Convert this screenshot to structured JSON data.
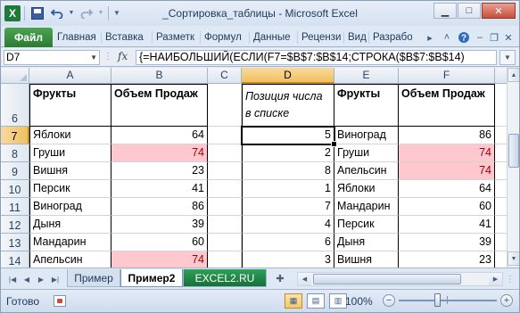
{
  "window": {
    "title": "_Сортировка_таблицы  -  Microsoft Excel",
    "app_icon": "excel-icon",
    "app_letter": "X"
  },
  "ribbon": {
    "file_tab": "Файл",
    "tabs": [
      "Главная",
      "Вставка",
      "Разметк",
      "Формул",
      "Данные",
      "Рецензи",
      "Вид",
      "Разрабо"
    ]
  },
  "formula_bar": {
    "name_box": "D7",
    "fx_label": "fx",
    "formula": "{=НАИБОЛЬШИЙ(ЕСЛИ(F7=$B$7:$B$14;СТРОКА($B$7:$B$14)"
  },
  "grid": {
    "columns": [
      "A",
      "B",
      "C",
      "D",
      "E",
      "F"
    ],
    "selected_column": "D",
    "rows": [
      "6",
      "7",
      "8",
      "9",
      "10",
      "11",
      "12",
      "13",
      "14"
    ],
    "selected_row": "7",
    "header_row": {
      "A": "Фрукты",
      "B": "Объем Продаж",
      "D": "Позиция числа в списке",
      "E": "Фрукты",
      "F": "Объем Продаж"
    },
    "data_rows": [
      {
        "A": "Яблоки",
        "B": "64",
        "D": "5",
        "E": "Виноград",
        "F": "86"
      },
      {
        "A": "Груши",
        "B": "74",
        "D": "2",
        "E": "Груши",
        "F": "74"
      },
      {
        "A": "Вишня",
        "B": "23",
        "D": "8",
        "E": "Апельсин",
        "F": "74"
      },
      {
        "A": "Персик",
        "B": "41",
        "D": "1",
        "E": "Яблоки",
        "F": "64"
      },
      {
        "A": "Виноград",
        "B": "86",
        "D": "7",
        "E": "Мандарин",
        "F": "60"
      },
      {
        "A": "Дыня",
        "B": "39",
        "D": "4",
        "E": "Персик",
        "F": "41"
      },
      {
        "A": "Мандарин",
        "B": "60",
        "D": "6",
        "E": "Дыня",
        "F": "39"
      },
      {
        "A": "Апельсин",
        "B": "74",
        "D": "3",
        "E": "Вишня",
        "F": "23"
      }
    ],
    "highlight_color": "#ffc7ce"
  },
  "sheet_tabs": {
    "tabs": [
      "Пример",
      "Пример2",
      "EXCEL2.RU"
    ],
    "active": "Пример2"
  },
  "status_bar": {
    "status": "Готово",
    "zoom": "100%",
    "zoom_minus": "−",
    "zoom_plus": "+"
  }
}
